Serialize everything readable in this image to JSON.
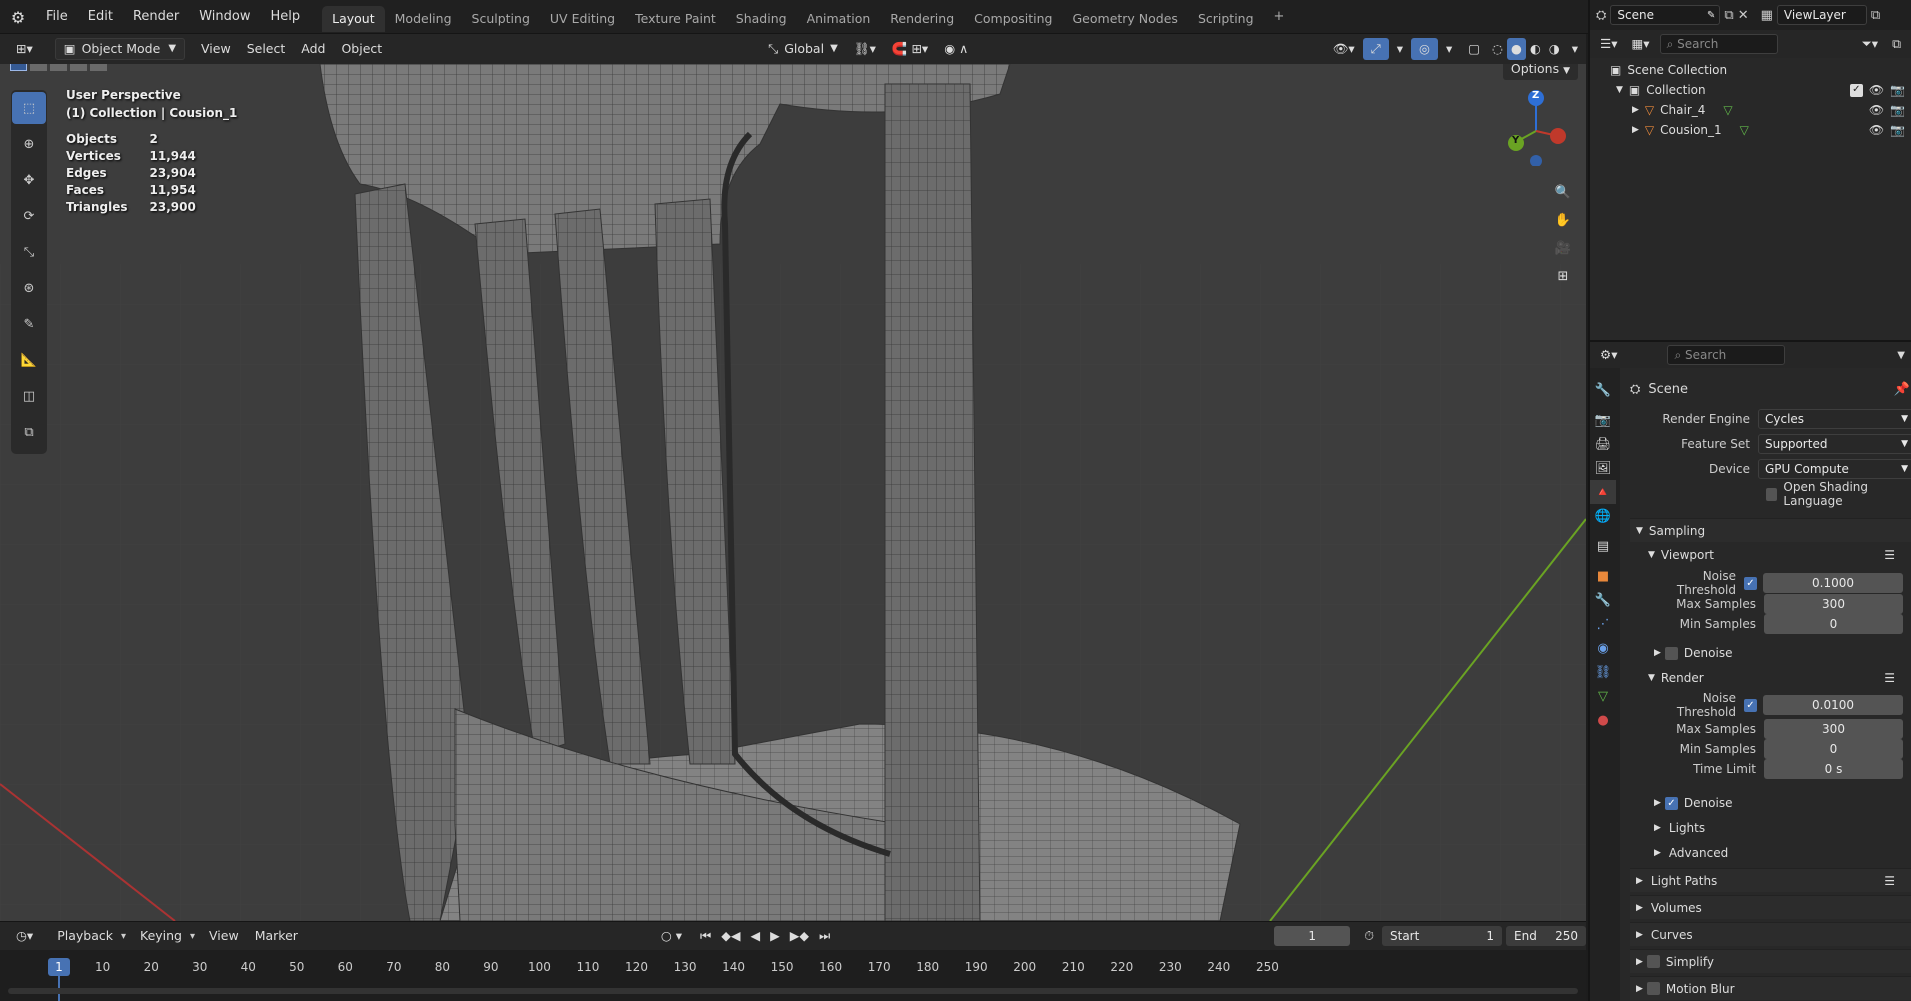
{
  "topbar": {
    "menus": [
      "File",
      "Edit",
      "Render",
      "Window",
      "Help"
    ],
    "workspaces": [
      "Layout",
      "Modeling",
      "Sculpting",
      "UV Editing",
      "Texture Paint",
      "Shading",
      "Animation",
      "Rendering",
      "Compositing",
      "Geometry Nodes",
      "Scripting"
    ],
    "active_workspace": "Layout",
    "add_tab": "+",
    "scene": "Scene",
    "view_layer": "ViewLayer"
  },
  "viewport_header": {
    "mode": "Object Mode",
    "menus": [
      "View",
      "Select",
      "Add",
      "Object"
    ],
    "transform_orientation": "Global",
    "options": "Options"
  },
  "viewport": {
    "view_name": "User Perspective",
    "collection_info": "(1) Collection | Cousion_1",
    "stats": [
      {
        "label": "Objects",
        "value": "2"
      },
      {
        "label": "Vertices",
        "value": "11,944"
      },
      {
        "label": "Edges",
        "value": "23,904"
      },
      {
        "label": "Faces",
        "value": "11,954"
      },
      {
        "label": "Triangles",
        "value": "23,900"
      }
    ],
    "gizmo": {
      "z": "Z",
      "y": "Y"
    }
  },
  "timeline": {
    "menus": [
      "Playback",
      "Keying",
      "View",
      "Marker"
    ],
    "current_frame": "1",
    "start_label": "Start",
    "start": "1",
    "end_label": "End",
    "end": "250",
    "ticks": [
      "1",
      "10",
      "20",
      "30",
      "40",
      "50",
      "60",
      "70",
      "80",
      "90",
      "100",
      "110",
      "120",
      "130",
      "140",
      "150",
      "160",
      "170",
      "180",
      "190",
      "200",
      "210",
      "220",
      "230",
      "240",
      "250"
    ]
  },
  "outliner": {
    "search_placeholder": "Search",
    "scene_collection": "Scene Collection",
    "collection": "Collection",
    "objects": [
      "Chair_4",
      "Cousion_1"
    ]
  },
  "properties": {
    "search_placeholder": "Search",
    "context": "Scene",
    "render_engine_label": "Render Engine",
    "render_engine": "Cycles",
    "feature_set_label": "Feature Set",
    "feature_set": "Supported",
    "device_label": "Device",
    "device": "GPU Compute",
    "osl_label": "Open Shading Language",
    "sampling": "Sampling",
    "viewport": "Viewport",
    "noise_threshold_label": "Noise Threshold",
    "viewport_noise_threshold": "0.1000",
    "max_samples_label": "Max Samples",
    "viewport_max_samples": "300",
    "min_samples_label": "Min Samples",
    "viewport_min_samples": "0",
    "denoise_label": "Denoise",
    "render": "Render",
    "render_noise_threshold": "0.0100",
    "render_max_samples": "300",
    "render_min_samples": "0",
    "time_limit_label": "Time Limit",
    "time_limit": "0 s",
    "lights": "Lights",
    "advanced": "Advanced",
    "light_paths": "Light Paths",
    "volumes": "Volumes",
    "curves": "Curves",
    "simplify": "Simplify",
    "motion_blur": "Motion Blur"
  },
  "colors": {
    "accent": "#4772b3",
    "x_axis": "#c0392b",
    "y_axis": "#6aa323",
    "z_axis": "#2e6fd6",
    "object_orange": "#e8883b",
    "mesh_green": "#62b84a"
  }
}
